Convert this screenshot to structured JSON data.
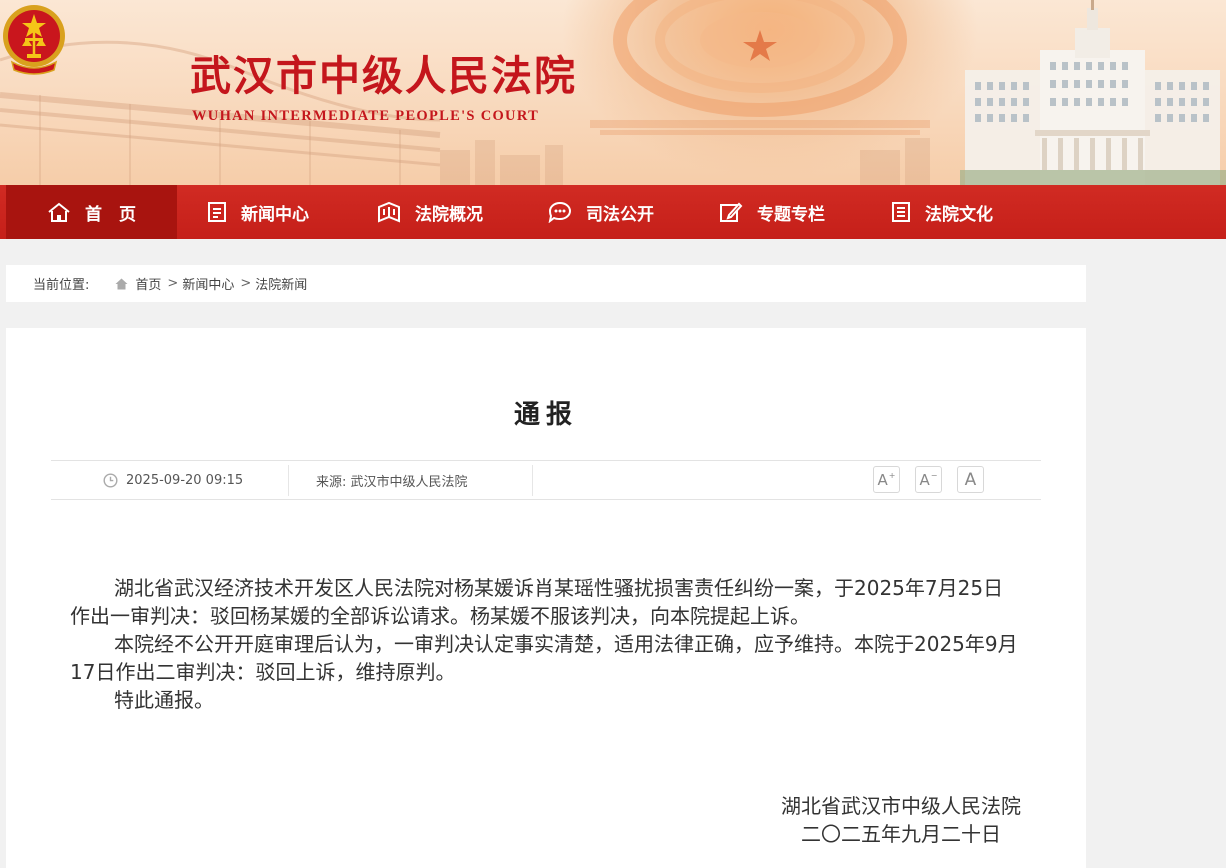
{
  "header": {
    "title": "武汉市中级人民法院",
    "subtitle": "WUHAN INTERMEDIATE PEOPLE'S COURT"
  },
  "nav": {
    "items": [
      {
        "label": "首　页",
        "icon": "home-icon"
      },
      {
        "label": "新闻中心",
        "icon": "document-icon"
      },
      {
        "label": "法院概况",
        "icon": "building-icon"
      },
      {
        "label": "司法公开",
        "icon": "chat-bubble-icon"
      },
      {
        "label": "专题专栏",
        "icon": "edit-icon"
      },
      {
        "label": "法院文化",
        "icon": "list-document-icon"
      }
    ]
  },
  "breadcrumb": {
    "label": "当前位置:",
    "items": [
      "首页",
      "新闻中心",
      "法院新闻"
    ],
    "separator": ">"
  },
  "article": {
    "title": "通报",
    "date": "2025-09-20 09:15",
    "source": "来源: 武汉市中级人民法院",
    "font_buttons": [
      "A",
      "A",
      "A"
    ],
    "paragraphs": [
      "湖北省武汉经济技术开发区人民法院对杨某媛诉肖某瑶性骚扰损害责任纠纷一案，于2025年7月25日作出一审判决：驳回杨某媛的全部诉讼请求。杨某媛不服该判决，向本院提起上诉。",
      "本院经不公开开庭审理后认为，一审判决认定事实清楚，适用法律正确，应予维持。本院于2025年9月17日作出二审判决：驳回上诉，维持原判。",
      "特此通报。"
    ],
    "signature": {
      "org": "湖北省武汉市中级人民法院",
      "date": "二〇二五年九月二十日"
    }
  },
  "colors": {
    "nav_bg": "#c8221b",
    "nav_active": "#a8140f",
    "brand_red": "#c4161c"
  }
}
